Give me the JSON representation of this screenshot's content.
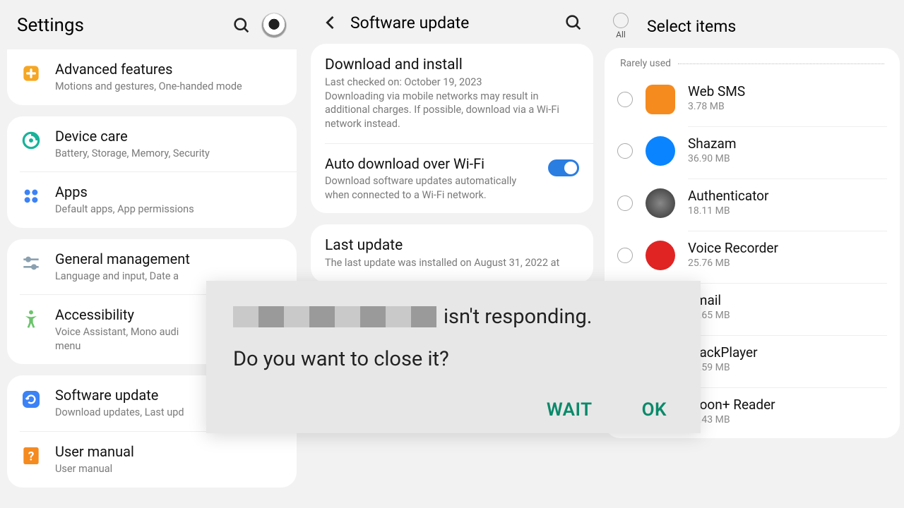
{
  "col1": {
    "title": "Settings",
    "items": [
      {
        "title": "Advanced features",
        "sub": "Motions and gestures, One-handed mode"
      },
      {
        "title": "Device care",
        "sub": "Battery, Storage, Memory, Security"
      },
      {
        "title": "Apps",
        "sub": "Default apps, App permissions"
      },
      {
        "title": "General management",
        "sub": "Language and input, Date a"
      },
      {
        "title": "Accessibility",
        "sub": "Voice Assistant, Mono audi\nmenu"
      },
      {
        "title": "Software update",
        "sub": "Download updates, Last upd"
      },
      {
        "title": "User manual",
        "sub": "User manual"
      }
    ]
  },
  "col2": {
    "title": "Software update",
    "download": {
      "title": "Download and install",
      "sub": "Last checked on: October 19, 2023\nDownloading via mobile networks may result in additional charges. If possible, download via a Wi-Fi network instead."
    },
    "auto": {
      "title": "Auto download over Wi-Fi",
      "sub": "Download software updates automatically when connected to a Wi-Fi network."
    },
    "last": {
      "title": "Last update",
      "sub": "The last update was installed on August 31, 2022 at"
    }
  },
  "col3": {
    "title": "Select items",
    "all": "All",
    "section": "Rarely used",
    "apps": [
      {
        "name": "Web SMS",
        "size": "3.78 MB",
        "color": "#f58a1f"
      },
      {
        "name": "Shazam",
        "size": "36.90 MB",
        "color": "#0a84ff"
      },
      {
        "name": "Authenticator",
        "size": "18.11 MB",
        "color": "#555"
      },
      {
        "name": "Voice Recorder",
        "size": "25.76 MB",
        "color": "#e02424"
      },
      {
        "name": "Email",
        "size": "83.65 MB",
        "color": ""
      },
      {
        "name": "BlackPlayer",
        "size": "55.59 MB",
        "color": ""
      },
      {
        "name": "Moon+ Reader",
        "size": "75.43 MB",
        "color": ""
      }
    ]
  },
  "dialog": {
    "suffix": "isn't responding.",
    "line2": "Do you want to close it?",
    "wait": "WAIT",
    "ok": "OK"
  }
}
